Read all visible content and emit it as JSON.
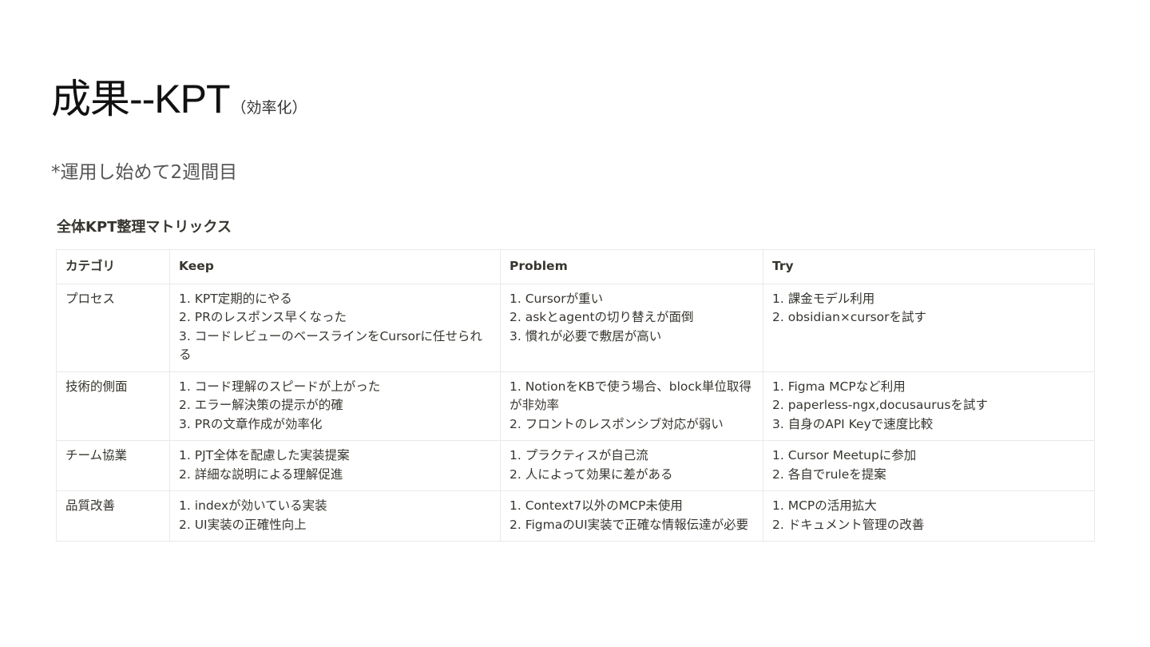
{
  "slide": {
    "title": "成果--KPT",
    "title_suffix": "（効率化）",
    "note": "*運用し始めて2週間目",
    "matrix_heading": "全体KPT整理マトリックス"
  },
  "table": {
    "headers": [
      "カテゴリ",
      "Keep",
      "Problem",
      "Try"
    ],
    "rows": [
      {
        "category": "プロセス",
        "keep": [
          "1. KPT定期的にやる",
          "2. PRのレスポンス早くなった",
          "3. コードレビューのベースラインをCursorに任せられる"
        ],
        "problem": [
          "1. Cursorが重い",
          "2. askとagentの切り替えが面倒",
          "3. 慣れが必要で敷居が高い"
        ],
        "try": [
          "1. 課金モデル利用",
          "2. obsidian×cursorを試す"
        ]
      },
      {
        "category": "技術的側面",
        "keep": [
          "1. コード理解のスピードが上がった",
          "2. エラー解決策の提示が的確",
          "3. PRの文章作成が効率化"
        ],
        "problem": [
          "1. NotionをKBで使う場合、block単位取得が非効率",
          "2. フロントのレスポンシブ対応が弱い"
        ],
        "try": [
          "1. Figma MCPなど利用",
          "2. paperless-ngx,docusaurusを試す",
          "3. 自身のAPI Keyで速度比較"
        ]
      },
      {
        "category": "チーム協業",
        "keep": [
          "1. PJT全体を配慮した実装提案",
          "2. 詳細な説明による理解促進"
        ],
        "problem": [
          "1. プラクティスが自己流",
          "2. 人によって効果に差がある"
        ],
        "try": [
          "1. Cursor Meetupに参加",
          "2. 各自でruleを提案"
        ]
      },
      {
        "category": "品質改善",
        "keep": [
          "1. indexが効いている実装",
          "2. UI実装の正確性向上"
        ],
        "problem": [
          "1. Context7以外のMCP未使用",
          "2. FigmaのUI実装で正確な情報伝達が必要"
        ],
        "try": [
          "1. MCPの活用拡大",
          "2. ドキュメント管理の改善"
        ]
      }
    ]
  }
}
